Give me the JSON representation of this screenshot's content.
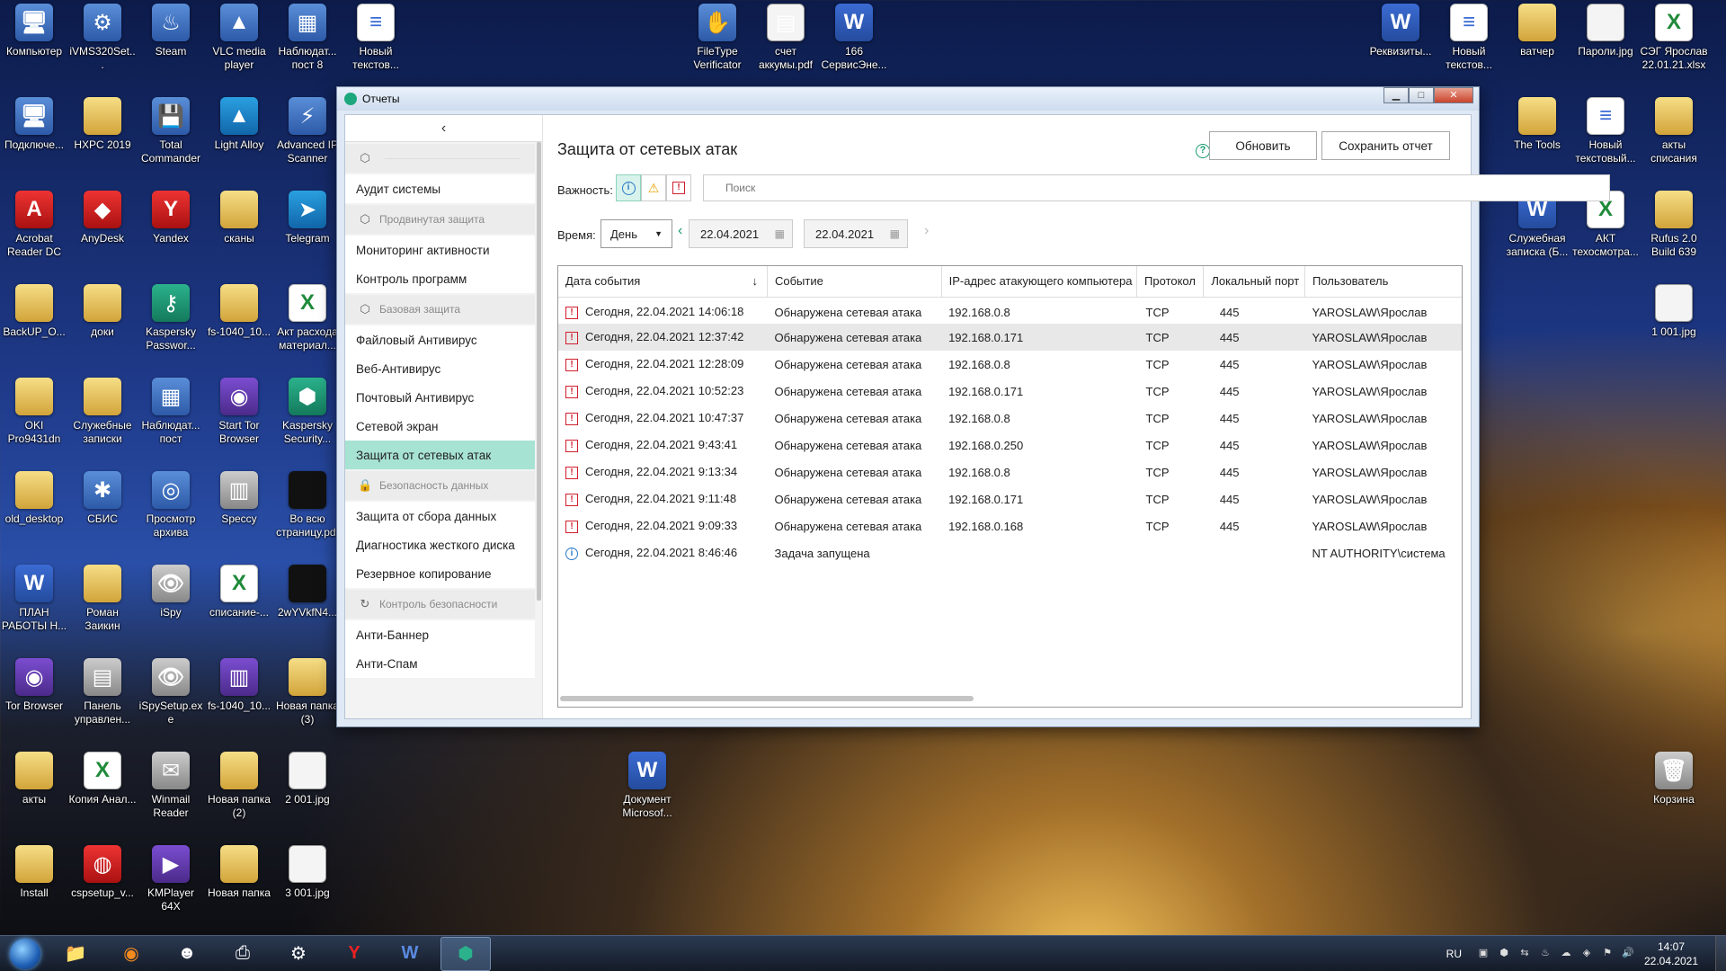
{
  "desktop_icons": [
    {
      "label": "Компьютер",
      "icon": "computer-icon",
      "glyph": "🖥"
    },
    {
      "label": "iVMS320Set...",
      "icon": "installer-icon",
      "glyph": "⚙"
    },
    {
      "label": "Steam",
      "icon": "steam-icon",
      "glyph": "♨"
    },
    {
      "label": "VLC media player",
      "icon": "vlc-icon",
      "glyph": "▲"
    },
    {
      "label": "Наблюдат... пост 8",
      "icon": "monitor-icon",
      "glyph": "▦"
    },
    {
      "label": "Новый текстов...",
      "icon": "text-file-icon",
      "glyph": "≡"
    },
    {
      "label": "FileType Verificator",
      "icon": "hand-icon",
      "glyph": "✋"
    },
    {
      "label": "счет аккумы.pdf",
      "icon": "pdf-icon",
      "glyph": "▤"
    },
    {
      "label": "166 СервисЭне...",
      "icon": "word-doc-icon",
      "glyph": "W"
    },
    {
      "label": "Реквизиты...",
      "icon": "word-doc-icon",
      "glyph": "W"
    },
    {
      "label": "Новый текстов...",
      "icon": "text-file-icon",
      "glyph": "≡"
    },
    {
      "label": "ватчер",
      "icon": "folder-icon",
      "glyph": ""
    },
    {
      "label": "Пароли.jpg",
      "icon": "image-icon",
      "glyph": ""
    },
    {
      "label": "СЭГ Ярослав 22.01.21.xlsx",
      "icon": "excel-icon",
      "glyph": "X"
    },
    {
      "label": "Подключе...",
      "icon": "remote-desktop-icon",
      "glyph": "🖥"
    },
    {
      "label": "HXPC 2019",
      "icon": "folder-icon",
      "glyph": ""
    },
    {
      "label": "Total Commander",
      "icon": "floppy-icon",
      "glyph": "💾"
    },
    {
      "label": "Light Alloy",
      "icon": "light-alloy-icon",
      "glyph": "▲"
    },
    {
      "label": "Advanced IP Scanner",
      "icon": "network-icon",
      "glyph": "⚡"
    },
    {
      "label": "The Tools",
      "icon": "folder-icon",
      "glyph": ""
    },
    {
      "label": "Новый текстовый...",
      "icon": "text-file-icon",
      "glyph": "≡"
    },
    {
      "label": "акты списания",
      "icon": "folder-icon",
      "glyph": ""
    },
    {
      "label": "Acrobat Reader DC",
      "icon": "acrobat-icon",
      "glyph": "A"
    },
    {
      "label": "AnyDesk",
      "icon": "anydesk-icon",
      "glyph": "◆"
    },
    {
      "label": "Yandex",
      "icon": "yandex-icon",
      "glyph": "Y"
    },
    {
      "label": "сканы",
      "icon": "folder-icon",
      "glyph": ""
    },
    {
      "label": "Telegram",
      "icon": "telegram-icon",
      "glyph": "➤"
    },
    {
      "label": "Служебная записка (Б...",
      "icon": "word-doc-icon",
      "glyph": "W"
    },
    {
      "label": "АКТ техосмотра...",
      "icon": "excel-icon",
      "glyph": "X"
    },
    {
      "label": "Rufus 2.0 Build 639",
      "icon": "folder-icon",
      "glyph": ""
    },
    {
      "label": "BackUP_O...",
      "icon": "folder-icon",
      "glyph": ""
    },
    {
      "label": "доки",
      "icon": "folder-icon",
      "glyph": ""
    },
    {
      "label": "Kaspersky Passwor...",
      "icon": "kaspersky-password-icon",
      "glyph": "⚷"
    },
    {
      "label": "fs-1040_10...",
      "icon": "folder-icon",
      "glyph": ""
    },
    {
      "label": "Акт расхода материал...",
      "icon": "excel-icon",
      "glyph": "X"
    },
    {
      "label": "1 001.jpg",
      "icon": "image-icon",
      "glyph": ""
    },
    {
      "label": "OKI Pro9431dn",
      "icon": "folder-icon",
      "glyph": ""
    },
    {
      "label": "Служебные записки",
      "icon": "folder-icon",
      "glyph": ""
    },
    {
      "label": "Наблюдат... пост",
      "icon": "monitor-icon",
      "glyph": "▦"
    },
    {
      "label": "Start Tor Browser",
      "icon": "tor-icon",
      "glyph": "◉"
    },
    {
      "label": "Kaspersky Security...",
      "icon": "kaspersky-icon",
      "glyph": "⬢"
    },
    {
      "label": "old_desktop",
      "icon": "folder-icon",
      "glyph": ""
    },
    {
      "label": "СБИС",
      "icon": "sbis-icon",
      "glyph": "✱"
    },
    {
      "label": "Просмотр архива",
      "icon": "archive-viewer-icon",
      "glyph": "◎"
    },
    {
      "label": "Speccy",
      "icon": "speccy-icon",
      "glyph": "▥"
    },
    {
      "label": "Во всю страницу.pdf",
      "icon": "pdf-icon",
      "glyph": ""
    },
    {
      "label": "ПЛАН РАБОТЫ Н...",
      "icon": "word-doc-icon",
      "glyph": "W"
    },
    {
      "label": "Роман Заикин",
      "icon": "folder-icon",
      "glyph": ""
    },
    {
      "label": "iSpy",
      "icon": "ispy-icon",
      "glyph": "👁"
    },
    {
      "label": "списание-...",
      "icon": "excel-icon",
      "glyph": "X"
    },
    {
      "label": "2wYVkfN4...",
      "icon": "image-icon",
      "glyph": ""
    },
    {
      "label": "Tor Browser",
      "icon": "tor-icon",
      "glyph": "◉"
    },
    {
      "label": "Панель управлен...",
      "icon": "control-panel-icon",
      "glyph": "▤"
    },
    {
      "label": "iSpySetup.exe",
      "icon": "ispy-icon",
      "glyph": "👁"
    },
    {
      "label": "fs-1040_10...",
      "icon": "winrar-icon",
      "glyph": "▥"
    },
    {
      "label": "Новая папка (3)",
      "icon": "folder-icon",
      "glyph": ""
    },
    {
      "label": "акты",
      "icon": "folder-icon",
      "glyph": ""
    },
    {
      "label": "Копия Анал...",
      "icon": "excel-icon",
      "glyph": "X"
    },
    {
      "label": "Winmail Reader",
      "icon": "winmail-icon",
      "glyph": "✉"
    },
    {
      "label": "Новая папка (2)",
      "icon": "folder-icon",
      "glyph": ""
    },
    {
      "label": "2 001.jpg",
      "icon": "image-icon",
      "glyph": ""
    },
    {
      "label": "Документ Microsof...",
      "icon": "word-doc-icon",
      "glyph": "W"
    },
    {
      "label": "Корзина",
      "icon": "recycle-bin-icon",
      "glyph": "🗑"
    },
    {
      "label": "Install",
      "icon": "folder-icon",
      "glyph": ""
    },
    {
      "label": "cspsetup_v...",
      "icon": "cryptopro-icon",
      "glyph": "◍"
    },
    {
      "label": "KMPlayer 64X",
      "icon": "kmplayer-icon",
      "glyph": "▶"
    },
    {
      "label": "Новая папка",
      "icon": "folder-icon",
      "glyph": ""
    },
    {
      "label": "3 001.jpg",
      "icon": "image-icon",
      "glyph": ""
    }
  ],
  "window": {
    "title": "Отчеты",
    "controls": {
      "minimize": "▁",
      "maximize": "□",
      "close": "✕"
    }
  },
  "sidebar": {
    "collapse_glyph": "‹",
    "items": [
      {
        "type": "group",
        "label": "",
        "icon": "shield-icon"
      },
      {
        "type": "item",
        "label": "Аудит системы"
      },
      {
        "type": "group",
        "label": "Продвинутая защита",
        "icon": "shield-icon"
      },
      {
        "type": "item",
        "label": "Мониторинг активности"
      },
      {
        "type": "item",
        "label": "Контроль программ"
      },
      {
        "type": "group",
        "label": "Базовая защита",
        "icon": "shield-icon"
      },
      {
        "type": "item",
        "label": "Файловый Антивирус"
      },
      {
        "type": "item",
        "label": "Веб-Антивирус"
      },
      {
        "type": "item",
        "label": "Почтовый Антивирус"
      },
      {
        "type": "item",
        "label": "Сетевой экран"
      },
      {
        "type": "item",
        "label": "Защита от сетевых атак",
        "active": true
      },
      {
        "type": "group",
        "label": "Безопасность данных",
        "icon": "lock-icon"
      },
      {
        "type": "item",
        "label": "Защита от сбора данных"
      },
      {
        "type": "item",
        "label": "Диагностика жесткого диска"
      },
      {
        "type": "item",
        "label": "Резервное копирование"
      },
      {
        "type": "group",
        "label": "Контроль безопасности",
        "icon": "refresh-icon"
      },
      {
        "type": "item",
        "label": "Анти-Баннер"
      },
      {
        "type": "item",
        "label": "Анти-Спам"
      }
    ]
  },
  "main": {
    "title": "Защита от сетевых атак",
    "help_glyph": "?",
    "refresh_label": "Обновить",
    "save_label": "Сохранить отчет",
    "importance_label": "Важность:",
    "severity": {
      "info": "i",
      "warning": "⚠",
      "critical": "!"
    },
    "search_placeholder": "Поиск",
    "time_label": "Время:",
    "period_value": "День",
    "date_from": "22.04.2021",
    "date_to": "22.04.2021",
    "columns": [
      "Дата события",
      "Событие",
      "IP-адрес атакующего компьютера",
      "Протокол",
      "Локальный порт",
      "Пользователь"
    ],
    "rows": [
      {
        "level": "critical",
        "date": "Сегодня, 22.04.2021 14:06:18",
        "event": "Обнаружена сетевая атака",
        "ip": "192.168.0.8",
        "proto": "TCP",
        "port": "445",
        "user": "YAROSLAW\\Ярослав"
      },
      {
        "level": "critical",
        "date": "Сегодня, 22.04.2021 12:37:42",
        "event": "Обнаружена сетевая атака",
        "ip": "192.168.0.171",
        "proto": "TCP",
        "port": "445",
        "user": "YAROSLAW\\Ярослав",
        "selected": true
      },
      {
        "level": "critical",
        "date": "Сегодня, 22.04.2021 12:28:09",
        "event": "Обнаружена сетевая атака",
        "ip": "192.168.0.8",
        "proto": "TCP",
        "port": "445",
        "user": "YAROSLAW\\Ярослав"
      },
      {
        "level": "critical",
        "date": "Сегодня, 22.04.2021 10:52:23",
        "event": "Обнаружена сетевая атака",
        "ip": "192.168.0.171",
        "proto": "TCP",
        "port": "445",
        "user": "YAROSLAW\\Ярослав"
      },
      {
        "level": "critical",
        "date": "Сегодня, 22.04.2021 10:47:37",
        "event": "Обнаружена сетевая атака",
        "ip": "192.168.0.8",
        "proto": "TCP",
        "port": "445",
        "user": "YAROSLAW\\Ярослав"
      },
      {
        "level": "critical",
        "date": "Сегодня, 22.04.2021 9:43:41",
        "event": "Обнаружена сетевая атака",
        "ip": "192.168.0.250",
        "proto": "TCP",
        "port": "445",
        "user": "YAROSLAW\\Ярослав"
      },
      {
        "level": "critical",
        "date": "Сегодня, 22.04.2021 9:13:34",
        "event": "Обнаружена сетевая атака",
        "ip": "192.168.0.8",
        "proto": "TCP",
        "port": "445",
        "user": "YAROSLAW\\Ярослав"
      },
      {
        "level": "critical",
        "date": "Сегодня, 22.04.2021 9:11:48",
        "event": "Обнаружена сетевая атака",
        "ip": "192.168.0.171",
        "proto": "TCP",
        "port": "445",
        "user": "YAROSLAW\\Ярослав"
      },
      {
        "level": "critical",
        "date": "Сегодня, 22.04.2021 9:09:33",
        "event": "Обнаружена сетевая атака",
        "ip": "192.168.0.168",
        "proto": "TCP",
        "port": "445",
        "user": "YAROSLAW\\Ярослав"
      },
      {
        "level": "info",
        "date": "Сегодня, 22.04.2021 8:46:46",
        "event": "Задача запущена",
        "ip": "",
        "proto": "",
        "port": "",
        "user": "NT AUTHORITY\\система"
      }
    ]
  },
  "taskbar": {
    "apps": [
      {
        "name": "explorer",
        "icon": "folder-icon",
        "glyph": "📁"
      },
      {
        "name": "firefox",
        "icon": "firefox-icon",
        "glyph": "◉"
      },
      {
        "name": "app",
        "icon": "hacker-icon",
        "glyph": "☻"
      },
      {
        "name": "printer",
        "icon": "printer-icon",
        "glyph": "⎙"
      },
      {
        "name": "network",
        "icon": "network-tool-icon",
        "glyph": "⚙"
      },
      {
        "name": "yandex",
        "icon": "yandex-icon",
        "glyph": "Y"
      },
      {
        "name": "word",
        "icon": "word-icon",
        "glyph": "W"
      },
      {
        "name": "kaspersky",
        "icon": "kaspersky-icon",
        "glyph": "⬢",
        "active": true
      }
    ],
    "lang": "RU",
    "time": "14:07",
    "date": "22.04.2021"
  },
  "colors": {
    "accent": "#a7e3d3",
    "critical": "#d01f2e",
    "info": "#2978c5",
    "brand": "#1a9a70"
  }
}
